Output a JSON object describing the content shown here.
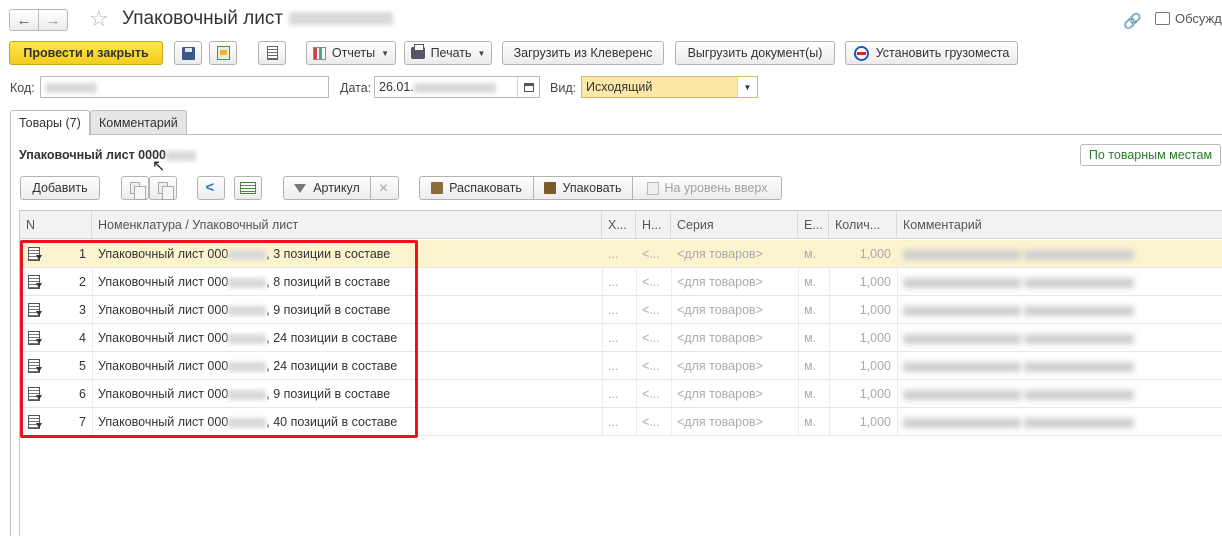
{
  "window": {
    "title": "Упаковочный лист",
    "discuss_label": "Обсуждени"
  },
  "toolbar": {
    "post_close": "Провести и закрыть",
    "reports": "Отчеты",
    "print": "Печать",
    "load_cleverence": "Загрузить из Клеверенс",
    "export_docs": "Выгрузить документ(ы)",
    "set_cargo": "Установить грузоместа"
  },
  "header": {
    "code_label": "Код:",
    "code_value": "",
    "date_label": "Дата:",
    "date_value": "26.01.",
    "kind_label": "Вид:",
    "kind_value": "Исходящий"
  },
  "tabs": [
    {
      "label": "Товары (7)"
    },
    {
      "label": "Комментарий"
    }
  ],
  "section": {
    "title": "Упаковочный лист 0000",
    "by_places_button": "По товарным местам"
  },
  "table_toolbar": {
    "add": "Добавить",
    "article": "Артикул",
    "unpack": "Распаковать",
    "pack": "Упаковать",
    "level_up": "На уровень вверх"
  },
  "grid": {
    "columns": [
      "N",
      "Номенклатура / Упаковочный лист",
      "Х...",
      "Н...",
      "Серия",
      "Е...",
      "Колич...",
      "Комментарий"
    ],
    "rows": [
      {
        "n": "1",
        "name_prefix": "Упаковочный лист 000",
        "name_suffix": ", 3 позиции в составе",
        "ch": "...",
        "h": "<...",
        "series": "<для товаров>",
        "unit": "м.",
        "qty": "1,000"
      },
      {
        "n": "2",
        "name_prefix": "Упаковочный лист 000",
        "name_suffix": ", 8 позиций в составе",
        "ch": "...",
        "h": "<...",
        "series": "<для товаров>",
        "unit": "м.",
        "qty": "1,000"
      },
      {
        "n": "3",
        "name_prefix": "Упаковочный лист 000",
        "name_suffix": ", 9 позиций в составе",
        "ch": "...",
        "h": "<...",
        "series": "<для товаров>",
        "unit": "м.",
        "qty": "1,000"
      },
      {
        "n": "4",
        "name_prefix": "Упаковочный лист 000",
        "name_suffix": ", 24 позиции в составе",
        "ch": "...",
        "h": "<...",
        "series": "<для товаров>",
        "unit": "м.",
        "qty": "1,000"
      },
      {
        "n": "5",
        "name_prefix": "Упаковочный лист 000",
        "name_suffix": ", 24 позиции в составе",
        "ch": "...",
        "h": "<...",
        "series": "<для товаров>",
        "unit": "м.",
        "qty": "1,000"
      },
      {
        "n": "6",
        "name_prefix": "Упаковочный лист 000",
        "name_suffix": ", 9 позиций в составе",
        "ch": "...",
        "h": "<...",
        "series": "<для товаров>",
        "unit": "м.",
        "qty": "1,000"
      },
      {
        "n": "7",
        "name_prefix": "Упаковочный лист 000",
        "name_suffix": ", 40 позиций в составе",
        "ch": "...",
        "h": "<...",
        "series": "<для товаров>",
        "unit": "м.",
        "qty": "1,000"
      }
    ]
  },
  "colors": {
    "primary_button": "#f5d327",
    "kind_field": "#fde7a9",
    "selected_row": "#fcf3cf",
    "highlight_frame": "#e8141e"
  },
  "icons": [
    "back-arrow-icon",
    "forward-arrow-icon",
    "star-icon",
    "link-icon",
    "discuss-icon",
    "save-icon",
    "post-icon",
    "list-icon",
    "report-icon",
    "print-icon",
    "cargo-icon",
    "calendar-icon",
    "copy-icon",
    "share-icon",
    "excel-icon",
    "filter-icon",
    "filter-clear-icon",
    "unpack-icon",
    "pack-icon",
    "level-up-icon",
    "row-doc-icon"
  ]
}
